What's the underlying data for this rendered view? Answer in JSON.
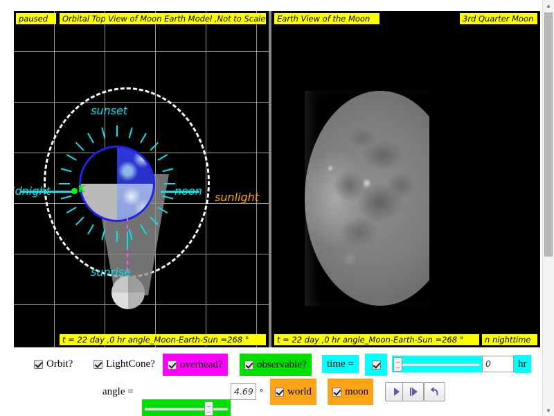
{
  "window": {
    "status_left": "paused"
  },
  "panels": {
    "left": {
      "title": "Orbital Top View of Moon Earth Model ,Not to Scale",
      "footer": "t = 22 day ,0 hr angle_Moon-Earth-Sun =268 °",
      "labels": {
        "sunset": "sunset",
        "sunrise": "sunrise",
        "midnight": "idnight",
        "noon": "noon",
        "sunlight": "sunlight",
        "marker": "K"
      }
    },
    "right": {
      "title": "Earth View of the Moon",
      "phase": "3rd Quarter Moon",
      "footer": "t = 22 day ,0 hr angle_Moon-Earth-Sun =268 °",
      "night_note": "n nighttime"
    }
  },
  "controls": {
    "orbit_label": "Orbit?",
    "lightcone_label": "LightCone?",
    "overhead_label": "overhead?",
    "observable_label": "observable?",
    "time_label": "time =",
    "time_value": "0",
    "time_unit": "hr",
    "angle_label": "angle =",
    "angle_value": "4.69",
    "angle_unit": "°",
    "world_label": "world",
    "moon_label": "moon",
    "play_icon": "play-icon",
    "step_icon": "step-forward-icon",
    "reset_icon": "reset-icon"
  },
  "colors": {
    "label_bar": "#ffff00",
    "diagram_text": "#00e5ee",
    "sunlight_text": "#ffa500",
    "overhead_bg": "#ff00ff",
    "observable_bg": "#00e000",
    "time_bg": "#00ffff",
    "world_bg": "#ffa317",
    "earth_outline": "#2222ee"
  }
}
